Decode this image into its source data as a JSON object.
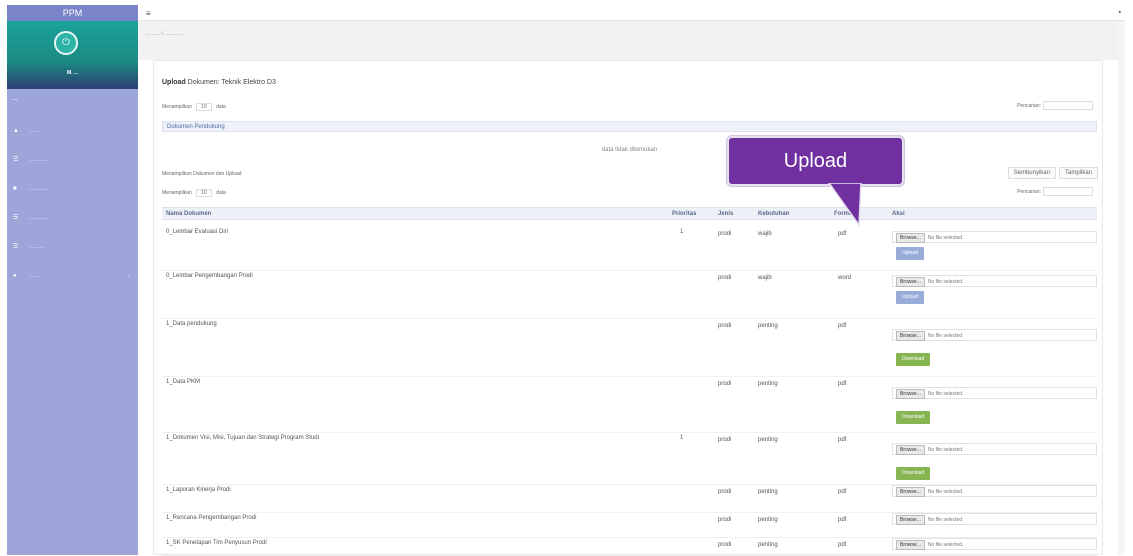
{
  "sidebar": {
    "brand": "PPM",
    "profile_name": "M. ...",
    "nav_header": "...",
    "items": [
      {
        "icon": "dashboard-icon",
        "label": "........."
      },
      {
        "icon": "list-icon",
        "label": "..............."
      },
      {
        "icon": "upload-icon",
        "label": ".............."
      },
      {
        "icon": "file-icon",
        "label": ".............."
      },
      {
        "icon": "report-icon",
        "label": "..........."
      },
      {
        "icon": "user-icon",
        "label": "........"
      }
    ]
  },
  "topbar": {
    "menu_icon": "≡",
    "user_icon": "▪"
  },
  "breadcrumb": ".......... / ..............",
  "page": {
    "title_bold": "Upload",
    "title_rest": " Dokumen: Teknik Elektro D3"
  },
  "top_table": {
    "show_label": "Menampilkan",
    "show_value": "10",
    "data_label": "data",
    "search_label": "Pencarian:",
    "header": "Dokumen Pendukung",
    "empty": "data tidak ditemukan"
  },
  "main_table": {
    "info_label": "Menampilkan Dokumen dan Upload",
    "buttons": [
      "Sembunyikan",
      "Tampilkan"
    ],
    "show_label": "Menampilkan",
    "show_value": "10",
    "data_label": "data",
    "search_label": "Pencarian:",
    "columns": [
      "Nama Dokumen",
      "Prioritas",
      "Jenis",
      "Kebutuhan",
      "Format",
      "Aksi"
    ],
    "file_button": "Browse...",
    "file_text": "No file selected.",
    "rows": [
      {
        "name": "0_Lembar Evaluasi Diri",
        "priority": "1",
        "type": "prodi",
        "need": "wajib",
        "format": "pdf",
        "action": "Upload",
        "action_style": "blue"
      },
      {
        "name": "0_Lembar Pengembangan Prodi",
        "priority": "",
        "type": "prodi",
        "need": "wajib",
        "format": "word",
        "action": "Upload",
        "action_style": "blue"
      },
      {
        "name": "1_Data pendukung",
        "priority": "",
        "type": "prodi",
        "need": "penting",
        "format": "pdf",
        "action": "Download",
        "action_style": "green"
      },
      {
        "name": "1_Data PKM",
        "priority": "",
        "type": "prodi",
        "need": "penting",
        "format": "pdf",
        "action": "Download",
        "action_style": "green"
      },
      {
        "name": "1_Dokumen Visi, Misi, Tujuan dan Strategi Program Studi",
        "priority": "1",
        "type": "prodi",
        "need": "penting",
        "format": "pdf",
        "action": "Download",
        "action_style": "green"
      },
      {
        "name": "1_Laporan Kinerja Prodi",
        "priority": "",
        "type": "prodi",
        "need": "penting",
        "format": "pdf",
        "action": "",
        "action_style": ""
      },
      {
        "name": "1_Rencana Pengembangan Prodi",
        "priority": "",
        "type": "prodi",
        "need": "penting",
        "format": "pdf",
        "action": "",
        "action_style": ""
      },
      {
        "name": "1_SK Penetapan Tim Penyusun Prodi",
        "priority": "",
        "type": "prodi",
        "need": "penting",
        "format": "pdf",
        "action": "",
        "action_style": ""
      }
    ]
  },
  "callout": {
    "label": "Upload"
  },
  "colors": {
    "sidebar": "#9ea6d9",
    "callout": "#7030a0",
    "blue_btn": "#98acd9",
    "green_btn": "#86b552"
  }
}
